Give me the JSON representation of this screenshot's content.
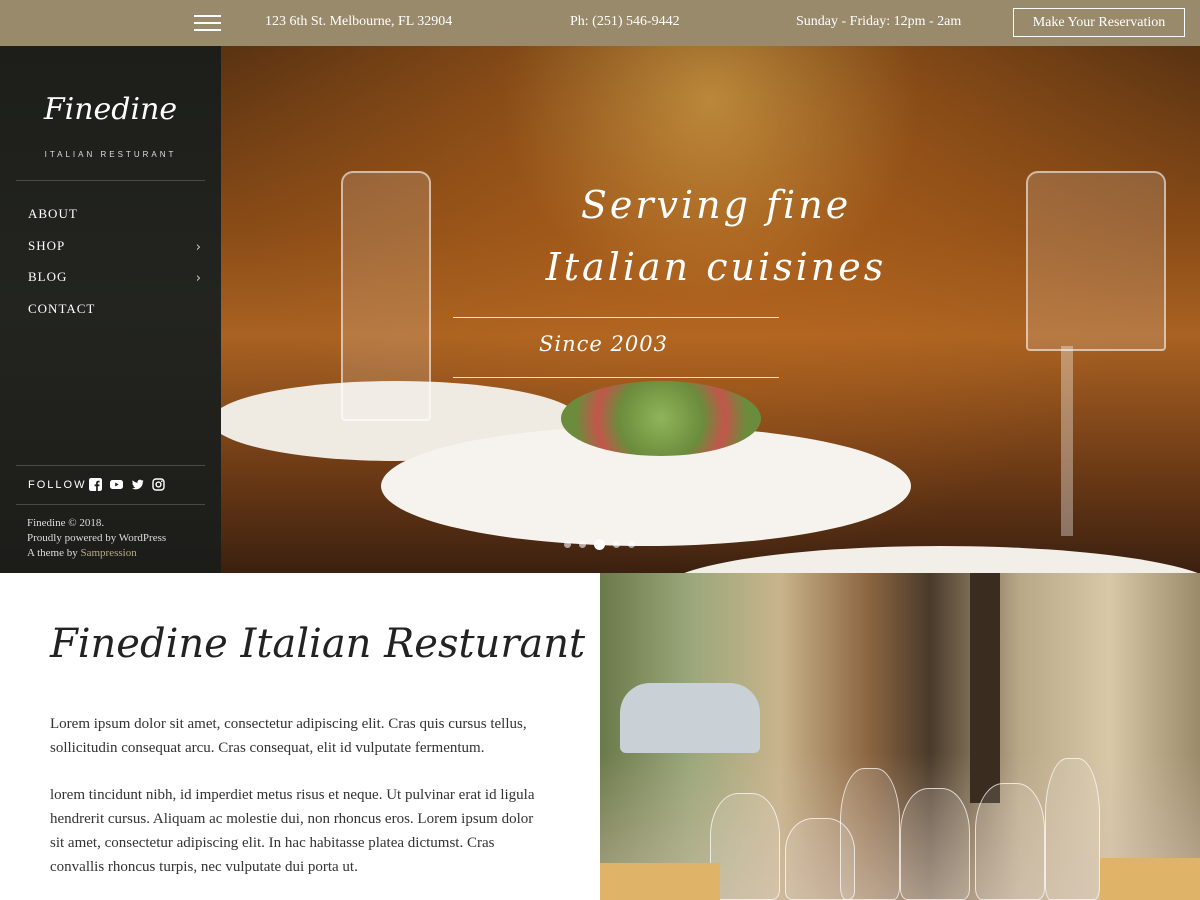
{
  "topbar": {
    "address": "123 6th St. Melbourne, FL 32904",
    "phone": "Ph: (251) 546-9442",
    "hours": "Sunday - Friday: 12pm - 2am",
    "reserve_label": "Make Your Reservation"
  },
  "sidebar": {
    "logo": "Finedine",
    "tagline": "ITALIAN RESTURANT",
    "nav": [
      {
        "label": "ABOUT",
        "has_submenu": false
      },
      {
        "label": "SHOP",
        "has_submenu": true
      },
      {
        "label": "BLOG",
        "has_submenu": true
      },
      {
        "label": "CONTACT",
        "has_submenu": false
      }
    ],
    "follow_label": "FOLLOW",
    "social_icons": [
      "facebook-icon",
      "youtube-icon",
      "twitter-icon",
      "instagram-icon"
    ],
    "footer": {
      "copyright": "Finedine © 2018.",
      "powered": "Proudly powered by WordPress",
      "theme_prefix": "A theme by",
      "theme_author": "Sampression"
    }
  },
  "hero": {
    "title_line1": "Serving fine",
    "title_line2": "Italian cuisines",
    "subtitle": "Since 2003",
    "slide_count": 5,
    "active_slide": 3
  },
  "content": {
    "title": "Finedine Italian Resturant",
    "paragraph1": "Lorem ipsum dolor sit amet, consectetur adipiscing elit. Cras quis cursus tellus, sollicitudin consequat arcu. Cras consequat, elit id vulputate fermentum.",
    "paragraph2": "lorem tincidunt nibh, id imperdiet metus risus et neque. Ut pulvinar erat id ligula hendrerit cursus. Aliquam ac molestie dui, non rhoncus eros. Lorem ipsum dolor sit amet, consectetur adipiscing elit. In hac habitasse platea dictumst. Cras convallis rhoncus turpis, nec vulputate dui porta ut."
  },
  "colors": {
    "topbar_bg": "#9a8a6c",
    "sidebar_bg": "#1d1e1a",
    "accent_link": "#b7a98a"
  }
}
